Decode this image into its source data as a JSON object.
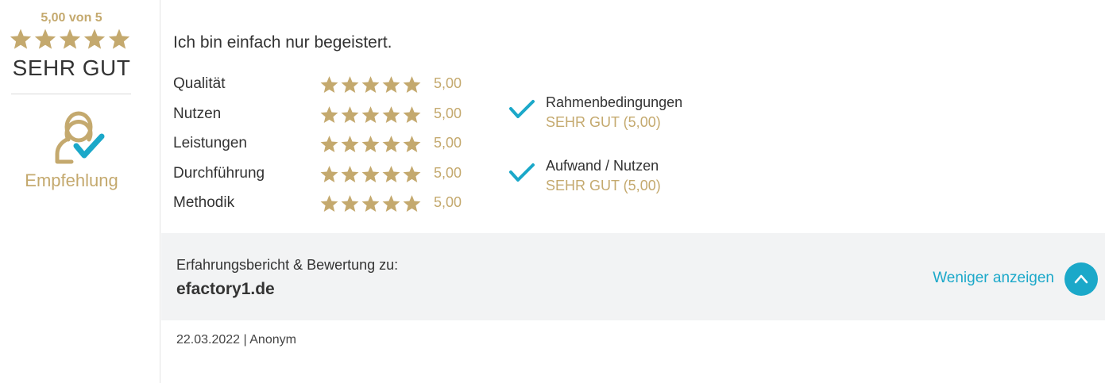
{
  "summary": {
    "score_text": "5,00 von 5",
    "stars": 5,
    "grade": "SEHR GUT",
    "recommend_icon": "person-check-icon",
    "recommend_label": "Empfehlung"
  },
  "review": {
    "headline": "Ich bin einfach nur begeistert.",
    "criteria": [
      {
        "label": "Qualität",
        "stars": 5,
        "value": "5,00"
      },
      {
        "label": "Nutzen",
        "stars": 5,
        "value": "5,00"
      },
      {
        "label": "Leistungen",
        "stars": 5,
        "value": "5,00"
      },
      {
        "label": "Durchführung",
        "stars": 5,
        "value": "5,00"
      },
      {
        "label": "Methodik",
        "stars": 5,
        "value": "5,00"
      }
    ],
    "extras": [
      {
        "icon": "checkmark-icon",
        "title": "Rahmenbedingungen",
        "grade": "SEHR GUT (5,00)"
      },
      {
        "icon": "checkmark-icon",
        "title": "Aufwand / Nutzen",
        "grade": "SEHR GUT (5,00)"
      }
    ]
  },
  "info_bar": {
    "caption": "Erfahrungsbericht & Bewertung zu:",
    "company": "efactory1.de",
    "toggle_label": "Weniger anzeigen",
    "toggle_icon": "chevron-up-icon"
  },
  "meta": {
    "date_author": "22.03.2022 | Anonym"
  },
  "colors": {
    "gold": "#c4a96e",
    "accent": "#1ba8c9",
    "text": "#333333",
    "panel_bg": "#f2f3f4"
  }
}
